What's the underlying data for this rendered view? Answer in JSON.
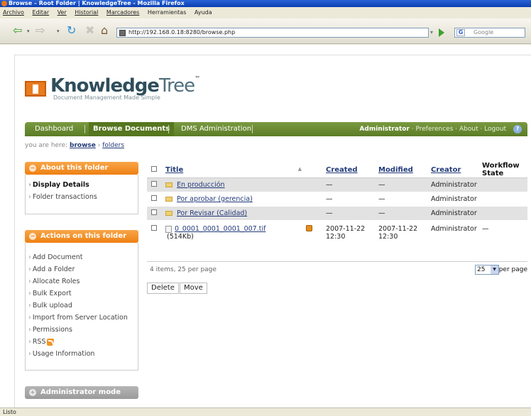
{
  "window": {
    "title": "Browse – Root Folder | KnowledgeTree - Mozilla Firefox"
  },
  "menubar": [
    "Archivo",
    "Editar",
    "Ver",
    "Historial",
    "Marcadores",
    "Herramientas",
    "Ayuda"
  ],
  "navbar": {
    "url": "http://192.168.0.18:8280/browse.php",
    "search_placeholder": "Google",
    "search_engine_icon": "G"
  },
  "logo": {
    "name_a": "Knowledge",
    "name_b": "Tree",
    "tm": "™",
    "tagline": "Document Management Made Simple"
  },
  "mainnav": {
    "items": [
      "Dashboard",
      "Browse Documents",
      "DMS Administration"
    ],
    "user": "Administrator",
    "links": " · Preferences · About · Logout",
    "help": "?"
  },
  "breadcrumb": {
    "prefix": "you are here: ",
    "crumb1": "browse",
    "sep": " › ",
    "crumb2": "folders"
  },
  "about_folder": {
    "title": "About this folder",
    "items": [
      "Display Details",
      "Folder transactions"
    ]
  },
  "actions_folder": {
    "title": "Actions on this folder",
    "items": [
      "Add Document",
      "Add a Folder",
      "Allocate Roles",
      "Bulk Export",
      "Bulk upload",
      "Import from Server Location",
      "Permissions",
      "RSS",
      "Usage Information"
    ]
  },
  "admin_mode": {
    "title": "Administrator mode"
  },
  "table": {
    "headers": {
      "title": "Title",
      "created": "Created",
      "modified": "Modified",
      "creator": "Creator",
      "workflow": "Workflow State"
    },
    "rows": [
      {
        "title": "En producción",
        "created": "—",
        "modified": "—",
        "creator": "Administrator",
        "workflow": ""
      },
      {
        "title": "Por aprobar (gerencia)",
        "created": "—",
        "modified": "—",
        "creator": "Administrator",
        "workflow": ""
      },
      {
        "title": "Por Revisar (Calidad)",
        "created": "—",
        "modified": "—",
        "creator": "Administrator",
        "workflow": ""
      }
    ],
    "doc": {
      "title": "0_0001_0001_0001_007.tif",
      "size": "(514Kb)",
      "created_date": "2007-11-22",
      "created_time": "12:30",
      "modified_date": "2007-11-22",
      "modified_time": "12:30",
      "creator": "Administrator",
      "workflow": "—"
    }
  },
  "pager": {
    "summary": "4 items, 25 per page",
    "per_page_value": "25",
    "per_page_label": "per page"
  },
  "buttons": {
    "delete": "Delete",
    "move": "Move"
  },
  "status": {
    "text": "Listo"
  }
}
